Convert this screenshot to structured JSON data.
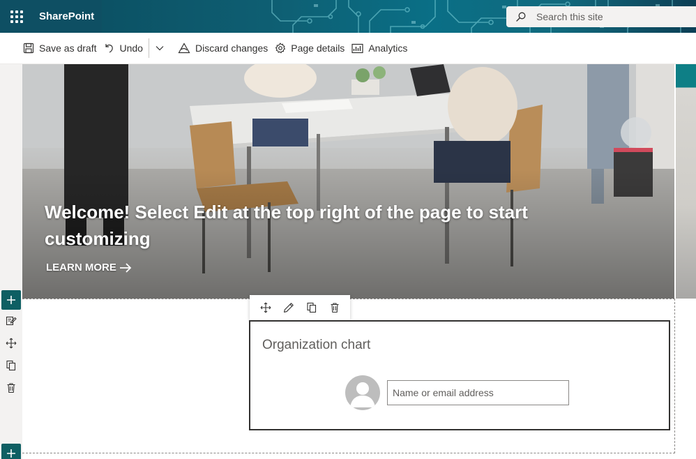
{
  "suite": {
    "app_name": "SharePoint",
    "search_placeholder": "Search this site"
  },
  "command_bar": {
    "save_draft": "Save as draft",
    "undo": "Undo",
    "discard": "Discard changes",
    "page_details": "Page details",
    "analytics": "Analytics"
  },
  "hero": {
    "title": "Welcome! Select Edit at the top right of the page to start customizing",
    "link": "LEARN MORE"
  },
  "org_chart": {
    "title": "Organization chart",
    "input_value": "",
    "input_placeholder": "Name or email address"
  },
  "colors": {
    "theme_teal": "#0e5f63",
    "suite_bar": "#0b4a5c"
  },
  "icons": {
    "waffle": "app-launcher-icon",
    "search": "search-icon",
    "save": "save-icon",
    "undo": "undo-icon",
    "chevron": "chevron-down-icon",
    "discard": "discard-icon",
    "page_details": "gear-icon",
    "analytics": "analytics-icon",
    "add": "add-icon",
    "edit_properties": "edit-properties-icon",
    "move": "move-icon",
    "duplicate": "duplicate-icon",
    "delete": "trash-icon",
    "edit": "pencil-icon",
    "arrow": "arrow-right-icon",
    "avatar": "person-placeholder-icon"
  }
}
